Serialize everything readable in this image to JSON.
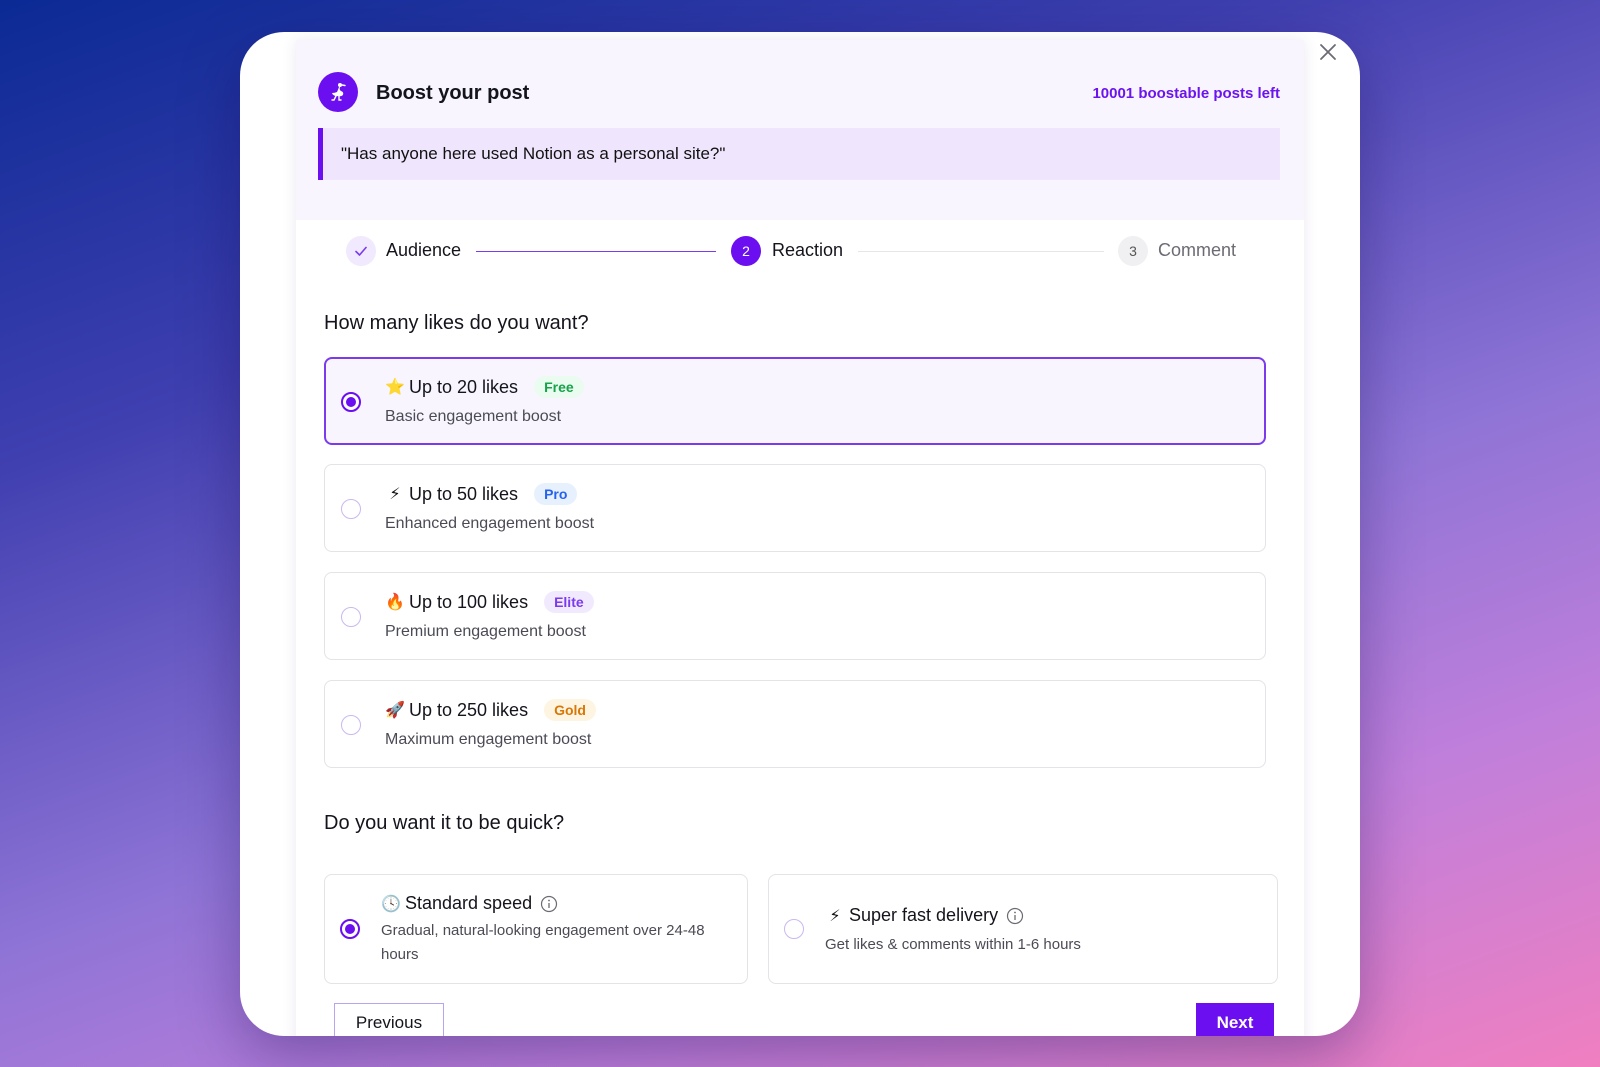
{
  "dialog": {
    "title": "Boost your post",
    "posts_left": "10001 boostable posts left",
    "quote": "\"Has anyone here used Notion as a personal site?\""
  },
  "stepper": {
    "steps": [
      {
        "label": "Audience",
        "number": "",
        "state": "completed"
      },
      {
        "label": "Reaction",
        "number": "2",
        "state": "active"
      },
      {
        "label": "Comment",
        "number": "3",
        "state": "upcoming"
      }
    ]
  },
  "likes": {
    "question": "How many likes do you want?",
    "options": [
      {
        "emoji": "⭐",
        "title": "Up to 20 likes",
        "badge": "Free",
        "badge_color": "#16a34a",
        "badge_bg": "#eafbf0",
        "description": "Basic engagement boost",
        "selected": true
      },
      {
        "emoji": "⚡",
        "title": "Up to 50 likes",
        "badge": "Pro",
        "badge_color": "#2563eb",
        "badge_bg": "#e7f1fe",
        "description": "Enhanced engagement boost",
        "selected": false
      },
      {
        "emoji": "🔥",
        "title": "Up to 100 likes",
        "badge": "Elite",
        "badge_color": "#7c3aed",
        "badge_bg": "#f1e9fd",
        "description": "Premium engagement boost",
        "selected": false
      },
      {
        "emoji": "🚀",
        "title": "Up to 250 likes",
        "badge": "Gold",
        "badge_color": "#d97706",
        "badge_bg": "#fdf5e1",
        "description": "Maximum engagement boost",
        "selected": false
      }
    ]
  },
  "speed": {
    "question": "Do you want it to be quick?",
    "options": [
      {
        "emoji": "🕓",
        "title": "Standard speed",
        "description": "Gradual, natural-looking engagement over 24-48 hours",
        "selected": true
      },
      {
        "emoji": "⚡",
        "title": "Super fast delivery",
        "description": "Get likes & comments within 1-6 hours",
        "selected": false
      }
    ]
  },
  "buttons": {
    "previous": "Previous",
    "next": "Next"
  },
  "colors": {
    "accent": "#6b0ff0",
    "accent_light": "#efe6fd",
    "header_bg": "#f8f5fe"
  }
}
